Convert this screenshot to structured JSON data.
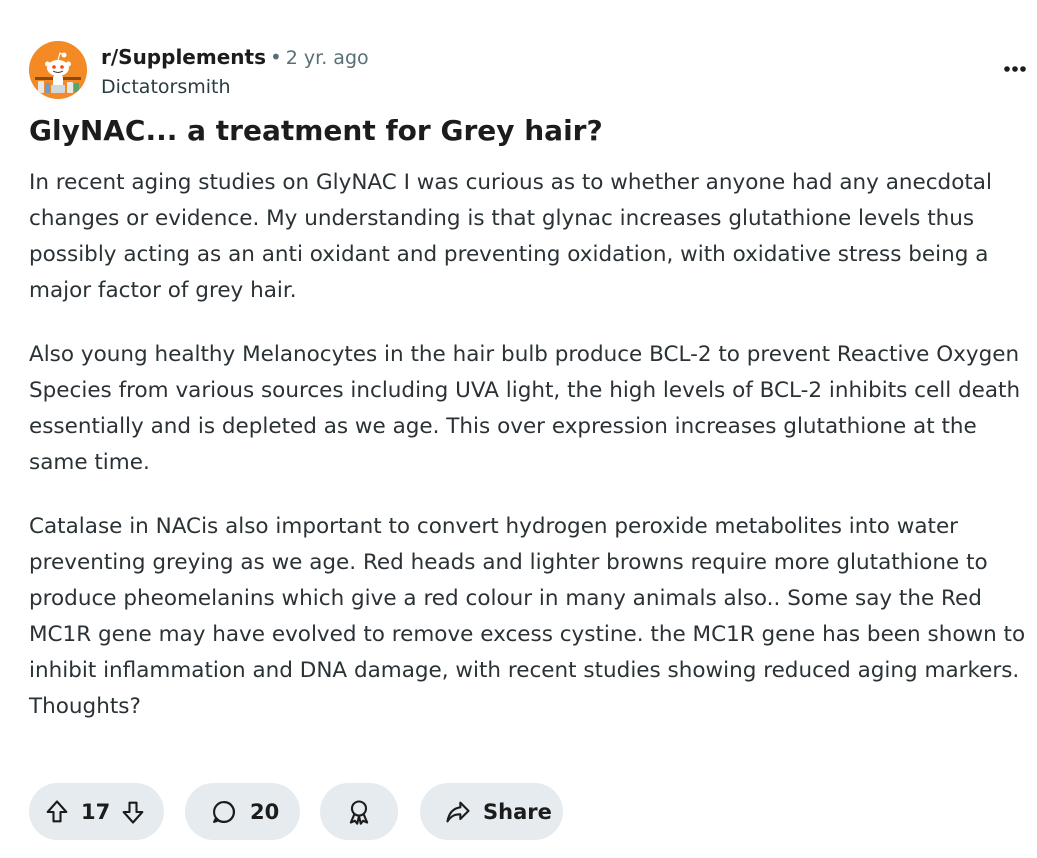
{
  "post": {
    "subreddit": "r/Supplements",
    "separator": "•",
    "age": "2 yr. ago",
    "author": "Dictatorsmith",
    "title": "GlyNAC... a treatment for Grey hair?",
    "paragraphs": [
      "In recent aging studies on GlyNAC I was curious as to whether anyone had any anecdotal changes or evidence. My understanding is that glynac increases glutathione levels thus possibly acting as an anti oxidant and preventing oxidation, with oxidative stress being a major factor of grey hair.",
      "Also young healthy Melanocytes in the hair bulb produce BCL-2 to prevent Reactive Oxygen Species from various sources including UVA light, the high levels of BCL-2 inhibits cell death essentially and is depleted as we age. This over expression increases glutathione at the same time.",
      "Catalase in NACis also important to convert hydrogen peroxide metabolites into water preventing greying as we age. Red heads and lighter browns require more glutathione to produce pheomelanins which give a red colour in many animals also.. Some say the Red MC1R gene may have evolved to remove excess cystine. the MC1R gene has been shown to inhibit inflammation and DNA damage, with recent studies showing reduced aging markers. Thoughts?"
    ]
  },
  "actions": {
    "vote_count": "17",
    "comment_count": "20",
    "share_label": "Share"
  },
  "icons": {
    "avatar": "subreddit-avatar",
    "more": "more-options-icon",
    "upvote": "upvote-arrow-icon",
    "downvote": "downvote-arrow-icon",
    "comment": "comment-bubble-icon",
    "award": "award-icon",
    "share": "share-arrow-icon"
  },
  "colors": {
    "avatar_bg": "#f48a26",
    "pill_bg": "#e5ebee",
    "meta_text": "#576f76"
  }
}
